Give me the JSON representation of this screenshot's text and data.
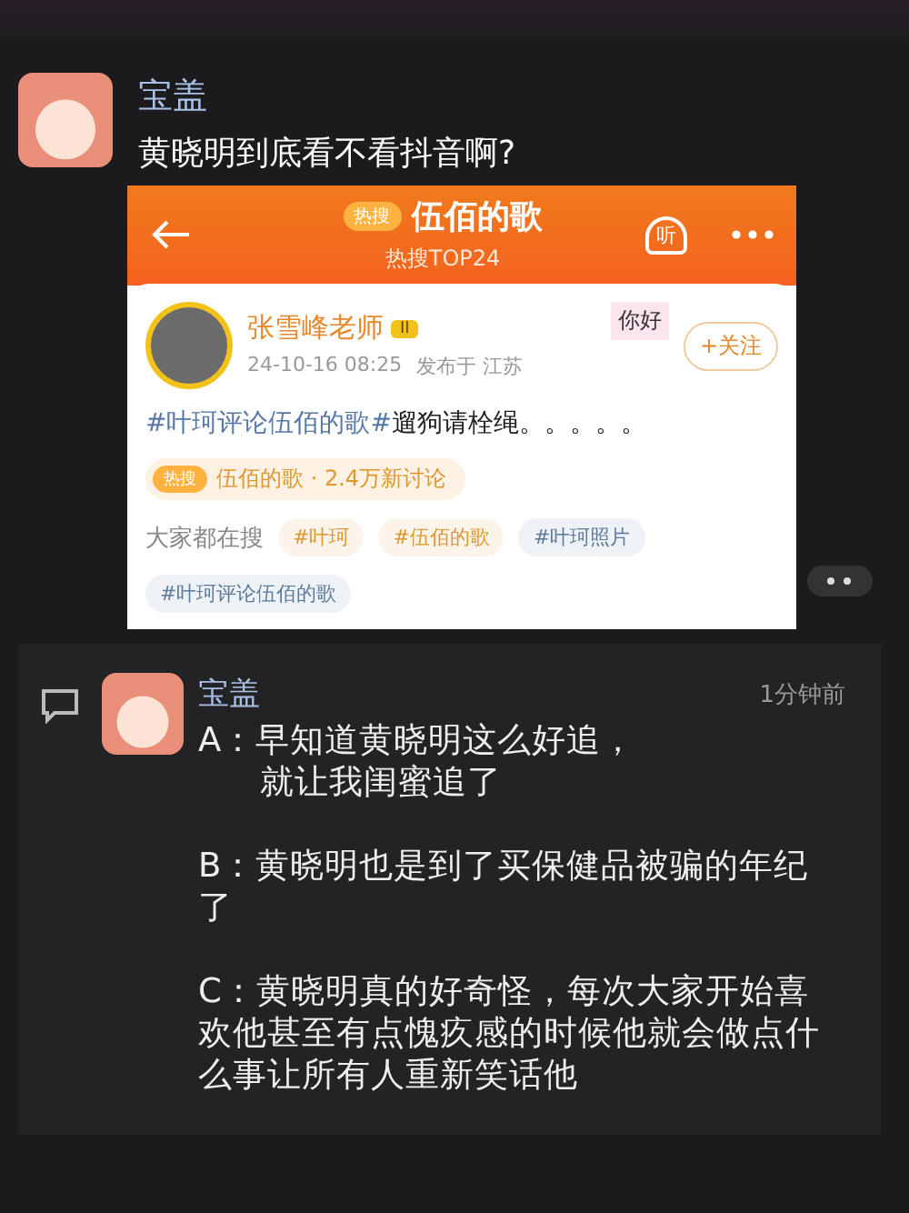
{
  "post": {
    "author": "宝盖",
    "text": "黄晓明到底看不看抖音啊?"
  },
  "embed": {
    "header": {
      "badge": "热搜",
      "title": "伍佰的歌",
      "subtitle": "热搜TOP24",
      "listen": "听"
    },
    "card": {
      "author": "张雪峰老师",
      "level": "II",
      "date": "24-10-16 08:25",
      "location": "发布于 江苏",
      "sticker": "你好",
      "follow": "+关注",
      "hashtag": "#叶珂评论伍佰的歌#",
      "text": "遛狗请栓绳。。。。。",
      "topic": {
        "badge": "热搜",
        "text": "伍佰的歌 · 2.4万新讨论"
      },
      "search_label": "大家都在搜",
      "tags": [
        {
          "text": "#叶珂",
          "color": "#e0962e"
        },
        {
          "text": "#伍佰的歌",
          "color": "#e0962e"
        },
        {
          "text": "#叶珂照片",
          "color": "#5b7a9c"
        },
        {
          "text": "#叶珂评论伍佰的歌",
          "color": "#5b7a9c"
        }
      ]
    }
  },
  "comment": {
    "author": "宝盖",
    "time": "1分钟前",
    "paragraphs": [
      {
        "kind": "start",
        "text": "A：早知道黄晓明这么好追，"
      },
      {
        "kind": "continuation",
        "text": "就让我闺蜜追了"
      },
      {
        "kind": "start",
        "text": "B：黄晓明也是到了买保健品被骗的年纪了"
      },
      {
        "kind": "start",
        "text": "C：黄晓明真的好奇怪，每次大家开始喜欢他甚至有点愧疚感的时候他就会做点什么事让所有人重新笑话他"
      }
    ]
  }
}
